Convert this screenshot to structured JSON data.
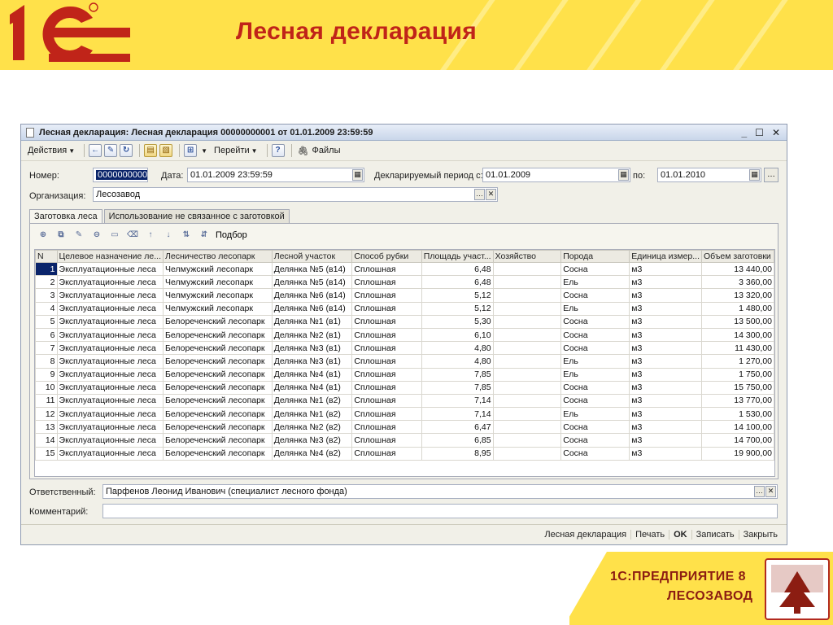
{
  "slide": {
    "title": "Лесная декларация",
    "brand_line1": "1С:ПРЕДПРИЯТИЕ 8",
    "brand_line2": "ЛЕСОЗАВОД"
  },
  "window": {
    "title": "Лесная декларация: Лесная декларация 00000000001 от 01.01.2009 23:59:59",
    "toolbar": {
      "actions": "Действия",
      "goto": "Перейти",
      "help": "?",
      "files": "Файлы"
    },
    "form": {
      "number_label": "Номер:",
      "number_value": "00000000001",
      "date_label": "Дата:",
      "date_value": "01.01.2009 23:59:59",
      "period_label": "Декларируемый период с:",
      "period_from": "01.01.2009",
      "period_to_label": "по:",
      "period_to": "01.01.2010",
      "org_label": "Организация:",
      "org_value": "Лесозавод",
      "responsible_label": "Ответственный:",
      "responsible_value": "Парфенов Леонид Иванович (специалист лесного фонда)",
      "comment_label": "Комментарий:",
      "comment_value": ""
    },
    "tabs": [
      "Заготовка леса",
      "Использование не связанное с заготовкой"
    ],
    "tab_toolbar": {
      "select_label": "Подбор"
    },
    "grid": {
      "columns": [
        "N",
        "Целевое назначение ле...",
        "Лесничество лесопарк",
        "Лесной участок",
        "Способ рубки",
        "Площадь участ...",
        "Хозяйство",
        "Порода",
        "Единица измер...",
        "Объем заготовки"
      ],
      "rows": [
        [
          "1",
          "Эксплуатационные леса",
          "Челмужский лесопарк",
          "Делянка №5 (в14)",
          "Сплошная",
          "6,48",
          "",
          "Сосна",
          "м3",
          "13 440,00"
        ],
        [
          "2",
          "Эксплуатационные леса",
          "Челмужский лесопарк",
          "Делянка №5 (в14)",
          "Сплошная",
          "6,48",
          "",
          "Ель",
          "м3",
          "3 360,00"
        ],
        [
          "3",
          "Эксплуатационные леса",
          "Челмужский лесопарк",
          "Делянка №6 (в14)",
          "Сплошная",
          "5,12",
          "",
          "Сосна",
          "м3",
          "13 320,00"
        ],
        [
          "4",
          "Эксплуатационные леса",
          "Челмужский лесопарк",
          "Делянка №6 (в14)",
          "Сплошная",
          "5,12",
          "",
          "Ель",
          "м3",
          "1 480,00"
        ],
        [
          "5",
          "Эксплуатационные леса",
          "Белореченский лесопарк",
          "Делянка №1 (в1)",
          "Сплошная",
          "5,30",
          "",
          "Сосна",
          "м3",
          "13 500,00"
        ],
        [
          "6",
          "Эксплуатационные леса",
          "Белореченский лесопарк",
          "Делянка №2 (в1)",
          "Сплошная",
          "6,10",
          "",
          "Сосна",
          "м3",
          "14 300,00"
        ],
        [
          "7",
          "Эксплуатационные леса",
          "Белореченский лесопарк",
          "Делянка №3 (в1)",
          "Сплошная",
          "4,80",
          "",
          "Сосна",
          "м3",
          "11 430,00"
        ],
        [
          "8",
          "Эксплуатационные леса",
          "Белореченский лесопарк",
          "Делянка №3 (в1)",
          "Сплошная",
          "4,80",
          "",
          "Ель",
          "м3",
          "1 270,00"
        ],
        [
          "9",
          "Эксплуатационные леса",
          "Белореченский лесопарк",
          "Делянка №4 (в1)",
          "Сплошная",
          "7,85",
          "",
          "Ель",
          "м3",
          "1 750,00"
        ],
        [
          "10",
          "Эксплуатационные леса",
          "Белореченский лесопарк",
          "Делянка №4 (в1)",
          "Сплошная",
          "7,85",
          "",
          "Сосна",
          "м3",
          "15 750,00"
        ],
        [
          "11",
          "Эксплуатационные леса",
          "Белореченский лесопарк",
          "Делянка №1 (в2)",
          "Сплошная",
          "7,14",
          "",
          "Сосна",
          "м3",
          "13 770,00"
        ],
        [
          "12",
          "Эксплуатационные леса",
          "Белореченский лесопарк",
          "Делянка №1 (в2)",
          "Сплошная",
          "7,14",
          "",
          "Ель",
          "м3",
          "1 530,00"
        ],
        [
          "13",
          "Эксплуатационные леса",
          "Белореченский лесопарк",
          "Делянка №2 (в2)",
          "Сплошная",
          "6,47",
          "",
          "Сосна",
          "м3",
          "14 100,00"
        ],
        [
          "14",
          "Эксплуатационные леса",
          "Белореченский лесопарк",
          "Делянка №3 (в2)",
          "Сплошная",
          "6,85",
          "",
          "Сосна",
          "м3",
          "14 700,00"
        ],
        [
          "15",
          "Эксплуатационные леса",
          "Белореченский лесопарк",
          "Делянка №4 (в2)",
          "Сплошная",
          "8,95",
          "",
          "Сосна",
          "м3",
          "19 900,00"
        ]
      ]
    },
    "footer": {
      "print_form": "Лесная декларация",
      "print": "Печать",
      "ok": "OK",
      "save": "Записать",
      "close": "Закрыть"
    }
  },
  "colors": {
    "brand_red": "#c02419",
    "brand_yellow": "#ffe14a",
    "selection": "#0a246a"
  },
  "icons": [
    "doc-icon",
    "minimize-icon",
    "maximize-icon",
    "close-icon",
    "calendar-icon",
    "ellipsis-icon",
    "clear-icon",
    "paperclip-icon",
    "add-row-icon",
    "copy-row-icon",
    "delete-row-icon",
    "move-up-icon",
    "move-down-icon",
    "sort-icon"
  ]
}
